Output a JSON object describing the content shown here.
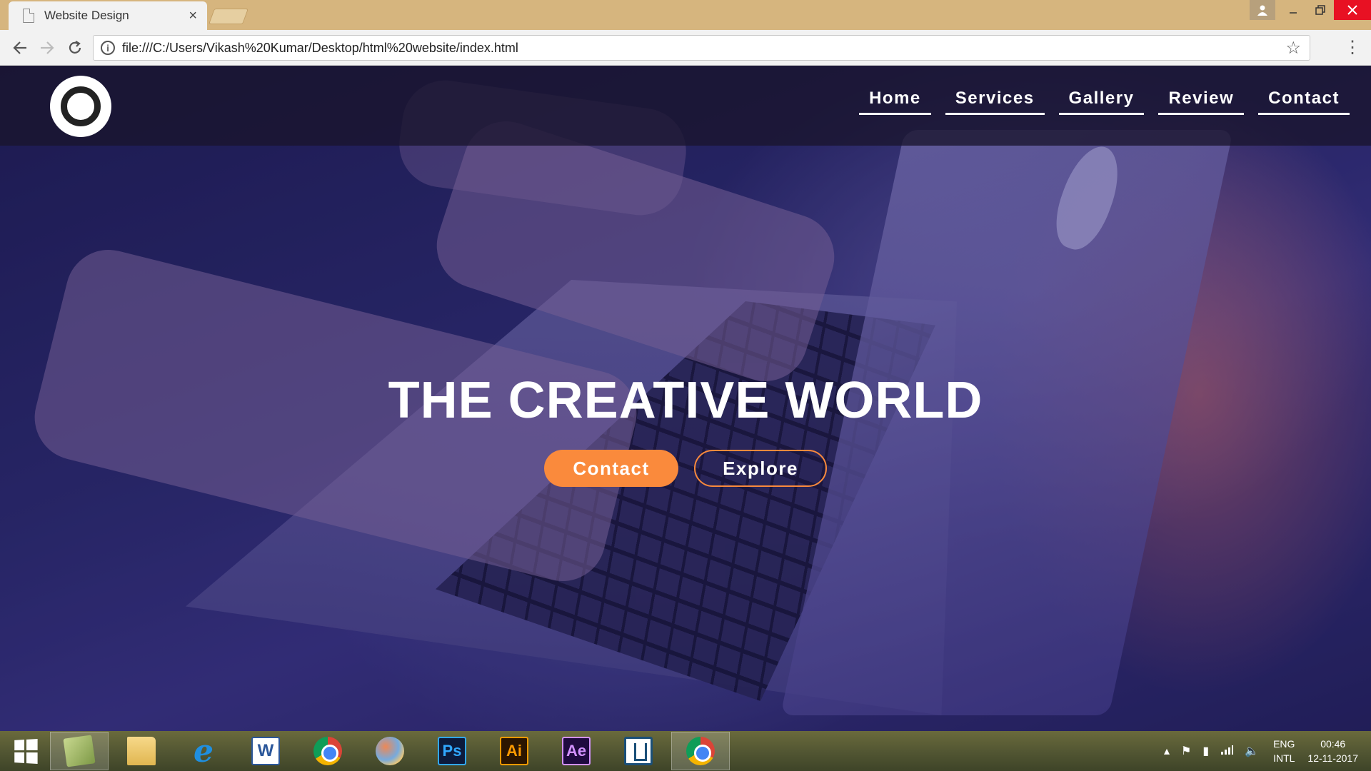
{
  "browser": {
    "tab_title": "Website Design",
    "tab_close": "×",
    "url": "file:///C:/Users/Vikash%20Kumar/Desktop/html%20website/index.html",
    "icons": {
      "back": "back-arrow-icon",
      "forward": "forward-arrow-icon",
      "reload": "reload-icon",
      "info": "info-icon",
      "star": "star-icon",
      "menu": "menu-icon"
    }
  },
  "site": {
    "nav": {
      "home": "Home",
      "services": "Services",
      "gallery": "Gallery",
      "review": "Review",
      "contact": "Contact"
    },
    "hero_title": "THE CREATIVE WORLD",
    "buttons": {
      "contact": "Contact",
      "explore": "Explore"
    },
    "colors": {
      "accent": "#fa8a3c",
      "header_bg": "#19142d"
    }
  },
  "taskbar": {
    "apps": [
      "notepad",
      "file-explorer",
      "internet-explorer",
      "word",
      "chrome",
      "paint",
      "photoshop",
      "illustrator",
      "after-effects",
      "brackets",
      "chrome-active"
    ],
    "labels": {
      "word": "W",
      "ps": "Ps",
      "ai": "Ai",
      "ae": "Ae",
      "ie": "e"
    },
    "tray": {
      "lang_top": "ENG",
      "lang_bottom": "INTL",
      "time": "00:46",
      "date": "12-11-2017"
    }
  }
}
